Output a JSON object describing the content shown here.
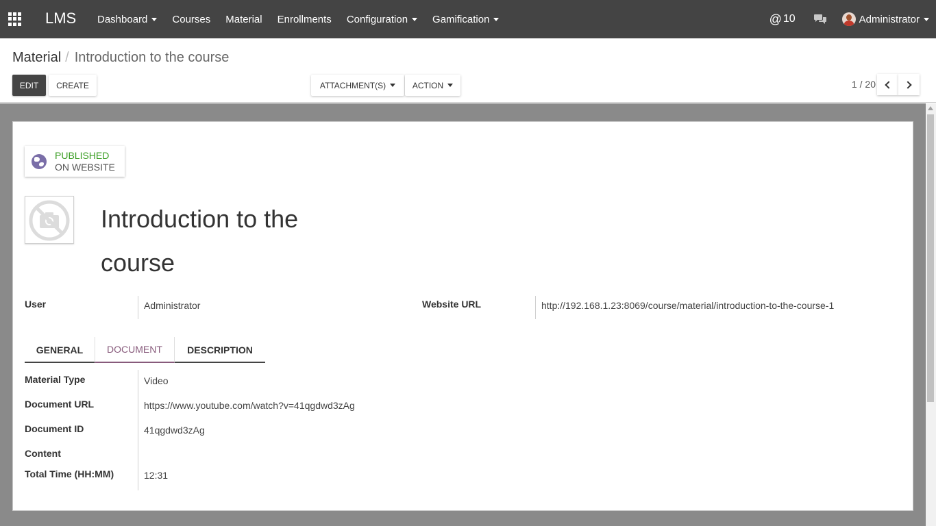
{
  "navbar": {
    "brand": "LMS",
    "menu": [
      {
        "label": "Dashboard",
        "dropdown": true
      },
      {
        "label": "Courses",
        "dropdown": false
      },
      {
        "label": "Material",
        "dropdown": false
      },
      {
        "label": "Enrollments",
        "dropdown": false
      },
      {
        "label": "Configuration",
        "dropdown": true
      },
      {
        "label": "Gamification",
        "dropdown": true
      }
    ],
    "mention_symbol": "@",
    "mention_count": "10",
    "user_name": "Administrator"
  },
  "breadcrumb": {
    "root": "Material",
    "separator": "/",
    "current": "Introduction to the course"
  },
  "toolbar": {
    "edit_label": "EDIT",
    "create_label": "CREATE",
    "attachments_label": "ATTACHMENT(S)",
    "action_label": "ACTION"
  },
  "pager": {
    "text": "1 / 20"
  },
  "record": {
    "publish_line1": "PUBLISHED",
    "publish_line2": "ON WEBSITE",
    "title": "Introduction to the course",
    "user_label": "User",
    "user_value": "Administrator",
    "website_url_label": "Website URL",
    "website_url_value": "http://192.168.1.23:8069/course/material/introduction-to-the-course-1"
  },
  "tabs": [
    {
      "label": "GENERAL",
      "active": false
    },
    {
      "label": "DOCUMENT",
      "active": true
    },
    {
      "label": "DESCRIPTION",
      "active": false
    }
  ],
  "document": {
    "material_type_label": "Material Type",
    "material_type_value": "Video",
    "document_url_label": "Document URL",
    "document_url_value": "https://www.youtube.com/watch?v=41qgdwd3zAg",
    "document_id_label": "Document ID",
    "document_id_value": "41qgdwd3zAg",
    "content_label": "Content",
    "total_time_label": "Total Time (HH:MM)",
    "total_time_value": "12:31"
  },
  "colors": {
    "navbar": "#444444",
    "accent": "#875a7b",
    "published": "#3a9d23",
    "background": "#8a8a8a"
  },
  "icons": [
    "apps-grid-icon",
    "chat-icon",
    "globe-icon",
    "no-photo-icon",
    "chevron-left-icon",
    "chevron-right-icon"
  ]
}
